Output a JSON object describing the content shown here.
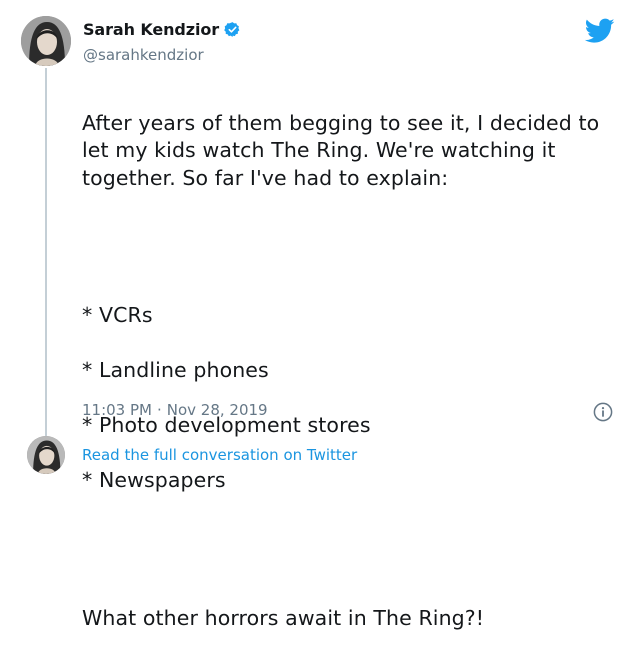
{
  "tweet": {
    "author": {
      "name": "Sarah Kendzior",
      "handle": "@sarahkendzior",
      "verified": true
    },
    "intro": "After years of them begging to see it, I decided to let my kids watch The Ring. We're watching it together. So far I've had to explain:",
    "list_items": [
      "* VCRs",
      "* Landline phones",
      "* Photo development stores",
      "* Newspapers"
    ],
    "closing": "What other horrors await in The Ring?!",
    "time": "11:03 PM",
    "separator": "·",
    "date": "Nov 28, 2019"
  },
  "footer": {
    "link_text": "Read the full conversation on Twitter"
  },
  "icons": {
    "brand": "twitter-bird-icon",
    "verified": "verified-badge-icon",
    "info": "info-icon"
  },
  "colors": {
    "brand_blue": "#1da1f2",
    "link_blue": "#1b95e0",
    "secondary_text": "#657786",
    "primary_text": "#14171a"
  }
}
